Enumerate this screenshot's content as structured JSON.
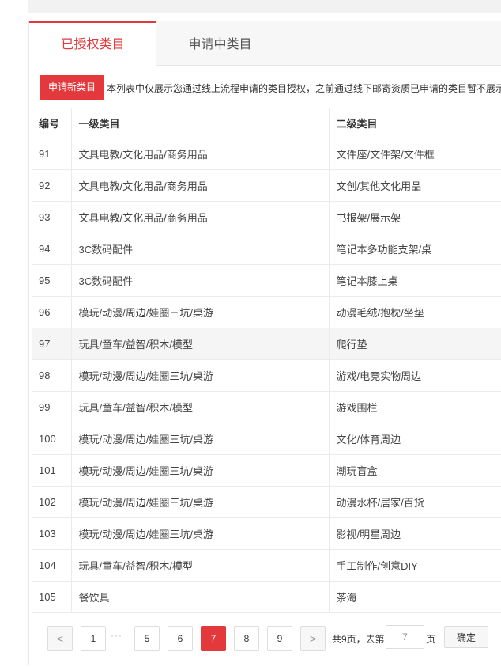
{
  "tabs": [
    {
      "label": "已授权类目",
      "active": true
    },
    {
      "label": "申请中类目",
      "active": false
    }
  ],
  "apply_button": "申请新类目",
  "notice": "本列表中仅展示您通过线上流程申请的类目授权，之前通过线下邮寄资质已申请的类目暂不展示",
  "table": {
    "headers": [
      "编号",
      "一级类目",
      "二级类目"
    ],
    "rows": [
      [
        "91",
        "文具电教/文化用品/商务用品",
        "文件座/文件架/文件框"
      ],
      [
        "92",
        "文具电教/文化用品/商务用品",
        "文创/其他文化用品"
      ],
      [
        "93",
        "文具电教/文化用品/商务用品",
        "书报架/展示架"
      ],
      [
        "94",
        "3C数码配件",
        "笔记本多功能支架/桌"
      ],
      [
        "95",
        "3C数码配件",
        "笔记本膝上桌"
      ],
      [
        "96",
        "模玩/动漫/周边/娃圈三坑/桌游",
        "动漫毛绒/抱枕/坐垫"
      ],
      [
        "97",
        "玩具/童车/益智/积木/模型",
        "爬行垫"
      ],
      [
        "98",
        "模玩/动漫/周边/娃圈三坑/桌游",
        "游戏/电竞实物周边"
      ],
      [
        "99",
        "玩具/童车/益智/积木/模型",
        "游戏围栏"
      ],
      [
        "100",
        "模玩/动漫/周边/娃圈三坑/桌游",
        "文化/体育周边"
      ],
      [
        "101",
        "模玩/动漫/周边/娃圈三坑/桌游",
        "潮玩盲盒"
      ],
      [
        "102",
        "模玩/动漫/周边/娃圈三坑/桌游",
        "动漫水杯/居家/百货"
      ],
      [
        "103",
        "模玩/动漫/周边/娃圈三坑/桌游",
        "影视/明星周边"
      ],
      [
        "104",
        "玩具/童车/益智/积木/模型",
        "手工制作/创意DIY"
      ],
      [
        "105",
        "餐饮具",
        "茶海"
      ]
    ],
    "highlighted_row": 6
  },
  "pagination": {
    "prev": "<",
    "next": ">",
    "first": "1",
    "ellipsis": "···",
    "pages": [
      "5",
      "6",
      "7",
      "8",
      "9"
    ],
    "current": "7",
    "total_text": "共9页，去第",
    "goto_value": "7",
    "page_suffix": "页",
    "confirm": "确定"
  },
  "colors": {
    "accent": "#e4393c"
  }
}
